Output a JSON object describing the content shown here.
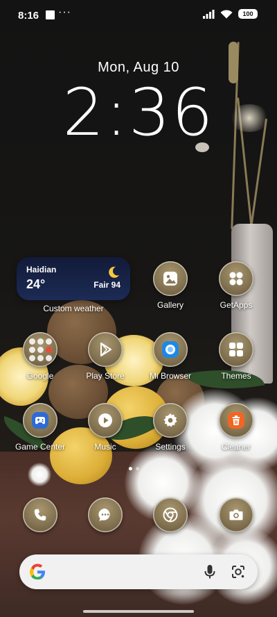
{
  "status_bar": {
    "time": "8:16",
    "more": "···",
    "battery": "100"
  },
  "lock": {
    "date": "Mon, Aug 10",
    "clock": "2:36"
  },
  "weather": {
    "city": "Haidian",
    "temp": "24°",
    "condition": "Fair 94",
    "label": "Custom weather"
  },
  "apps": {
    "gallery": "Gallery",
    "getapps": "GetApps",
    "google": "Google",
    "playstore": "Play Store",
    "mibrowser": "Mi Browser",
    "themes": "Themes",
    "gamecenter": "Game Center",
    "music": "Music",
    "settings": "Settings",
    "cleaner": "Cleaner"
  },
  "search": {
    "placeholder": ""
  },
  "colors": {
    "weather_bg": "#1c2b55",
    "moon": "#f5c842",
    "cleaner": "#f26522",
    "browser": "#1e88e5",
    "gamecenter": "#2e6bd6"
  }
}
